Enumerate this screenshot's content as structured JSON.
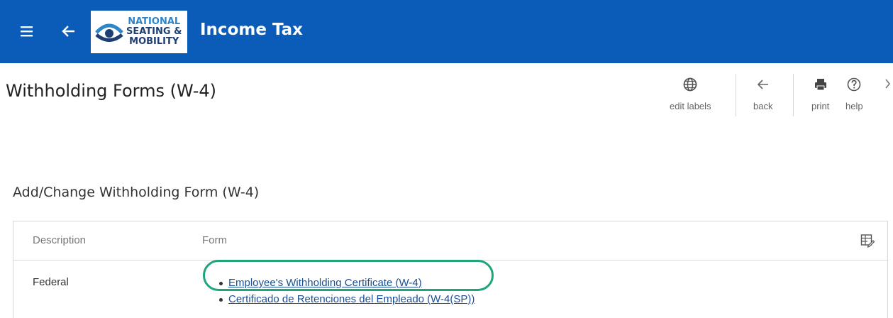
{
  "header": {
    "app_title": "Income Tax",
    "logo_lines": [
      "NATIONAL",
      "SEATING &",
      "MOBILITY"
    ],
    "brand_color": "#0a5cb8",
    "icons": [
      "menu-icon",
      "back-arrow-icon"
    ]
  },
  "page": {
    "title": "Withholding Forms (W-4)"
  },
  "toolbar": {
    "edit_labels": "edit labels",
    "back": "back",
    "print": "print",
    "help": "help"
  },
  "section": {
    "title": "Add/Change Withholding Form (W-4)"
  },
  "table": {
    "columns": [
      "Description",
      "Form"
    ],
    "rows": [
      {
        "description": "Federal",
        "links": [
          "Employee's Withholding Certificate (W-4)",
          "Certificado de Retenciones del Empleado (W-4(SP))"
        ]
      }
    ]
  },
  "highlight_color": "#1ea57e"
}
